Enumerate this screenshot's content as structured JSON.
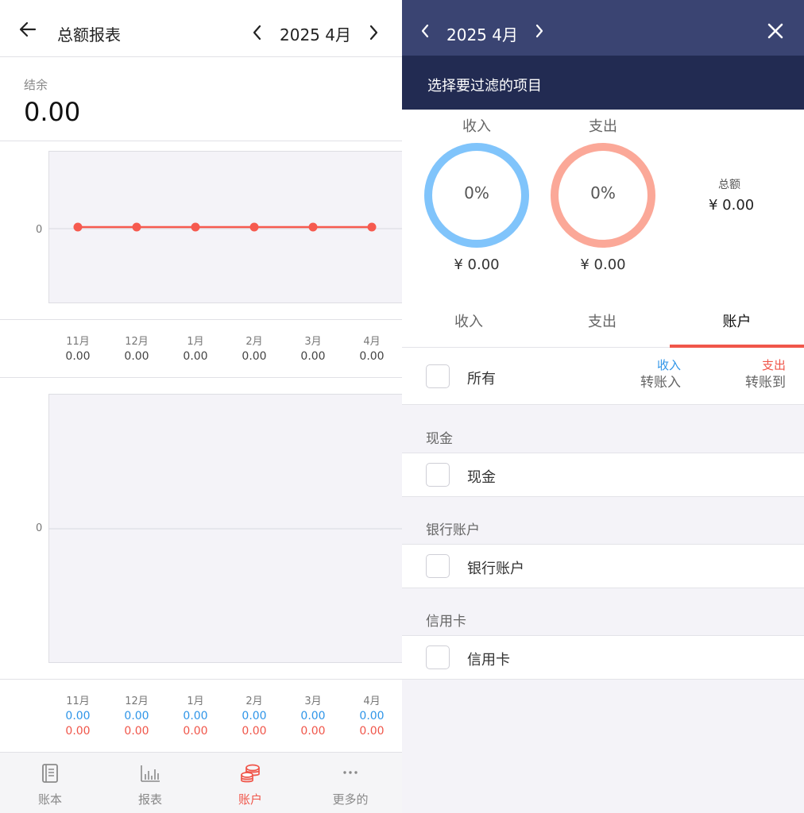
{
  "left": {
    "header": {
      "title": "总额报表",
      "month": "2025 4月"
    },
    "balance": {
      "label": "结余",
      "value": "0.00"
    },
    "chart1": {
      "y_tick": "0"
    },
    "chart2": {
      "y_tick": "0"
    },
    "months": [
      {
        "label": "11月",
        "total": "0.00",
        "income": "0.00",
        "expense": "0.00"
      },
      {
        "label": "12月",
        "total": "0.00",
        "income": "0.00",
        "expense": "0.00"
      },
      {
        "label": "1月",
        "total": "0.00",
        "income": "0.00",
        "expense": "0.00"
      },
      {
        "label": "2月",
        "total": "0.00",
        "income": "0.00",
        "expense": "0.00"
      },
      {
        "label": "3月",
        "total": "0.00",
        "income": "0.00",
        "expense": "0.00"
      },
      {
        "label": "4月",
        "total": "0.00",
        "income": "0.00",
        "expense": "0.00"
      }
    ],
    "tabbar": {
      "items": [
        {
          "label": "账本",
          "icon": "book-icon"
        },
        {
          "label": "报表",
          "icon": "bar-chart-icon"
        },
        {
          "label": "账户",
          "icon": "coins-icon"
        },
        {
          "label": "更多的",
          "icon": "more-icon"
        }
      ],
      "active_index": 2
    }
  },
  "right": {
    "header": {
      "month": "2025 4月",
      "subtitle": "选择要过滤的项目"
    },
    "summary": {
      "income": {
        "title": "收入",
        "percent": "0%",
        "amount": "¥ 0.00",
        "color": "#80c4fb"
      },
      "expense": {
        "title": "支出",
        "percent": "0%",
        "amount": "¥ 0.00",
        "color": "#fba898"
      },
      "total_label": "总额",
      "total_value": "¥ 0.00"
    },
    "filter_tabs": [
      {
        "label": "收入"
      },
      {
        "label": "支出"
      },
      {
        "label": "账户"
      }
    ],
    "active_filter_tab": 2,
    "all_row": {
      "label": "所有",
      "col1_top": "收入",
      "col1_bottom": "转账入",
      "col2_top": "支出",
      "col2_bottom": "转账到"
    },
    "groups": [
      {
        "header": "现金",
        "item": "现金"
      },
      {
        "header": "银行账户",
        "item": "银行账户"
      },
      {
        "header": "信用卡",
        "item": "信用卡"
      }
    ]
  },
  "colors": {
    "accent": "#f0564a",
    "income": "#2f95e8",
    "header_dark": "#222b52",
    "header": "#3a4472",
    "line": "#f65a4f"
  },
  "chart_data": [
    {
      "type": "line",
      "categories": [
        "11月",
        "12月",
        "1月",
        "2月",
        "3月",
        "4月"
      ],
      "values": [
        0,
        0,
        0,
        0,
        0,
        0
      ],
      "y_tick_labels": [
        "0"
      ]
    },
    {
      "type": "bar",
      "categories": [
        "11月",
        "12月",
        "1月",
        "2月",
        "3月",
        "4月"
      ],
      "series": [
        {
          "values": [
            0,
            0,
            0,
            0,
            0,
            0
          ]
        },
        {
          "values": [
            0,
            0,
            0,
            0,
            0,
            0
          ]
        }
      ],
      "y_tick_labels": [
        "0"
      ]
    }
  ]
}
